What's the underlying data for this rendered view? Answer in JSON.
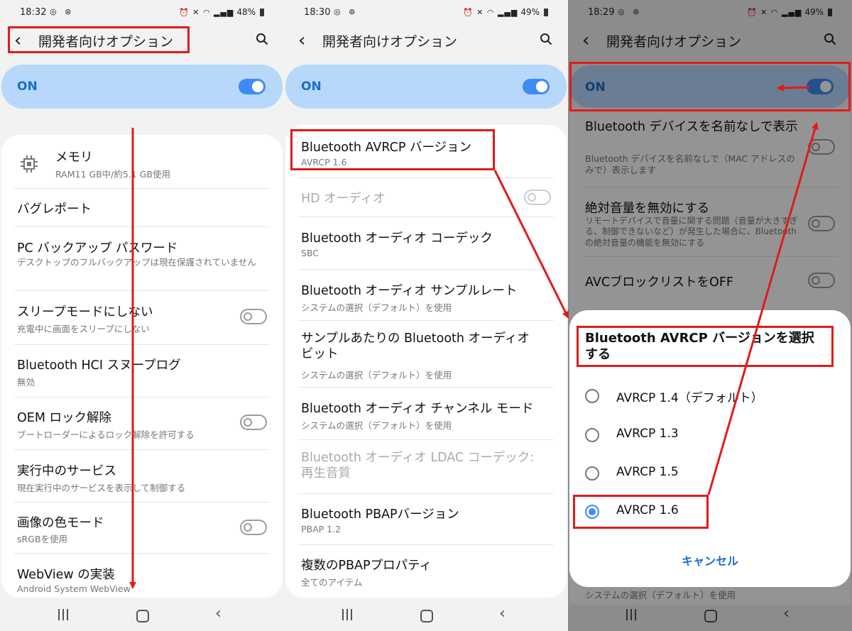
{
  "phones": [
    {
      "status": {
        "time": "18:32",
        "battery": "48%"
      },
      "title": "開発者向けオプション",
      "on_label": "ON",
      "rows": [
        {
          "title": "メモリ",
          "sub": "RAM11 GB中/約5.1 GB使用"
        },
        {
          "title": "バグレポート"
        },
        {
          "title": "PC バックアップ パスワード",
          "sub": "デスクトップのフルバックアップは現在保護されていません"
        },
        {
          "title": "スリープモードにしない",
          "sub": "充電中に画面をスリープにしない"
        },
        {
          "title": "Bluetooth HCI スヌープログ",
          "sub": "無効"
        },
        {
          "title": "OEM ロック解除",
          "sub": "ブートローダーによるロック解除を許可する"
        },
        {
          "title": "実行中のサービス",
          "sub": "現在実行中のサービスを表示して制御する"
        },
        {
          "title": "画像の色モード",
          "sub": "sRGBを使用"
        },
        {
          "title": "WebView の実装",
          "sub": "Android System WebView"
        }
      ]
    },
    {
      "status": {
        "time": "18:30",
        "battery": "49%"
      },
      "title": "開発者向けオプション",
      "on_label": "ON",
      "rows": [
        {
          "title": "Bluetooth AVRCP バージョン",
          "sub": "AVRCP 1.6"
        },
        {
          "title": "HD オーディオ"
        },
        {
          "title": "Bluetooth オーディオ コーデック",
          "sub": "SBC"
        },
        {
          "title": "Bluetooth オーディオ サンプルレート",
          "sub": "システムの選択（デフォルト）を使用"
        },
        {
          "title": "サンプルあたりの Bluetooth オーディオ ビット",
          "sub": "システムの選択（デフォルト）を使用"
        },
        {
          "title": "Bluetooth オーディオ チャンネル モード",
          "sub": "システムの選択（デフォルト）を使用"
        },
        {
          "title": "Bluetooth オーディオ LDAC コーデック: 再生音質"
        },
        {
          "title": "Bluetooth PBAPバージョン",
          "sub": "PBAP 1.2"
        },
        {
          "title": "複数のPBAPプロパティ",
          "sub": "全てのアイテム"
        }
      ]
    },
    {
      "status": {
        "time": "18:29",
        "battery": "49%"
      },
      "title": "開発者向けオプション",
      "on_label": "ON",
      "rows": [
        {
          "title": "Bluetooth デバイスを名前なしで表示",
          "sub": "Bluetooth デバイスを名前なしで（MAC アドレスのみで）表示します"
        },
        {
          "title": "絶対音量を無効にする",
          "sub": "リモートデバイスで音量に関する問題（音量が大きすぎる、制御できないなど）が発生した場合に、Bluetooth の絶対音量の機能を無効にする"
        },
        {
          "title": "AVCブロックリストをOFF"
        }
      ],
      "footer_sub": "システムの選択（デフォルト）を使用",
      "dialog": {
        "title": "Bluetooth AVRCP バージョンを選択する",
        "options": [
          "AVRCP 1.4（デフォルト）",
          "AVRCP 1.3",
          "AVRCP 1.5",
          "AVRCP 1.6"
        ],
        "selected": "AVRCP 1.6",
        "cancel": "キャンセル"
      }
    }
  ],
  "colors": {
    "accent": "#3e8bf5",
    "on_card": "#b8d8fb",
    "annotation": "#e21a1a"
  }
}
